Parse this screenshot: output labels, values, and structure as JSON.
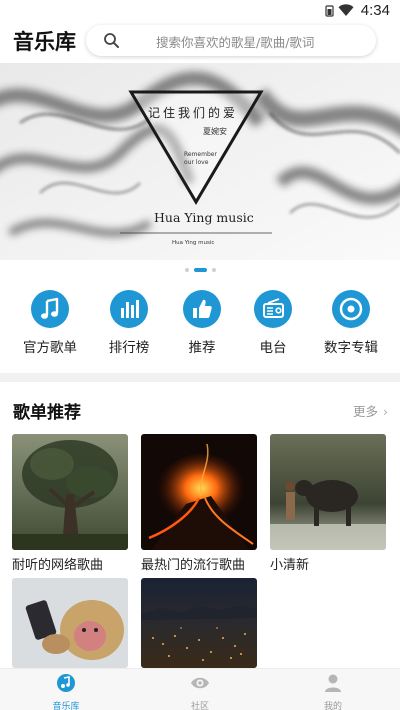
{
  "status_bar": {
    "time": "4:34"
  },
  "header": {
    "title": "音乐库"
  },
  "search": {
    "placeholder": "搜索你喜欢的歌星/歌曲/歌词"
  },
  "banner": {
    "title_cn": "记住我们的爱",
    "author": "夏婉安",
    "subtitle_en_1": "Remember",
    "subtitle_en_2": "our love",
    "brand": "Hua Ying music",
    "brand_small": "Hua Ying music",
    "page_count": 3,
    "active_page": 2
  },
  "quick_nav": [
    {
      "label": "官方歌单",
      "icon": "music-note-icon"
    },
    {
      "label": "排行榜",
      "icon": "bar-chart-icon"
    },
    {
      "label": "推荐",
      "icon": "thumbs-up-icon"
    },
    {
      "label": "电台",
      "icon": "radio-icon"
    },
    {
      "label": "数字专辑",
      "icon": "disc-icon"
    }
  ],
  "section": {
    "title": "歌单推荐",
    "more_label": "更多"
  },
  "playlists": [
    {
      "label": "耐听的网络歌曲"
    },
    {
      "label": "最热门的流行歌曲"
    },
    {
      "label": "小清新"
    },
    {
      "label": ""
    },
    {
      "label": ""
    }
  ],
  "bottom_nav": [
    {
      "label": "音乐库",
      "icon": "music-library-icon",
      "active": true
    },
    {
      "label": "社区",
      "icon": "community-icon",
      "active": false
    },
    {
      "label": "我的",
      "icon": "profile-icon",
      "active": false
    }
  ],
  "colors": {
    "accent": "#1f97d4",
    "text": "#222222",
    "muted": "#8a8a8a",
    "divider": "#f1f1f1"
  }
}
